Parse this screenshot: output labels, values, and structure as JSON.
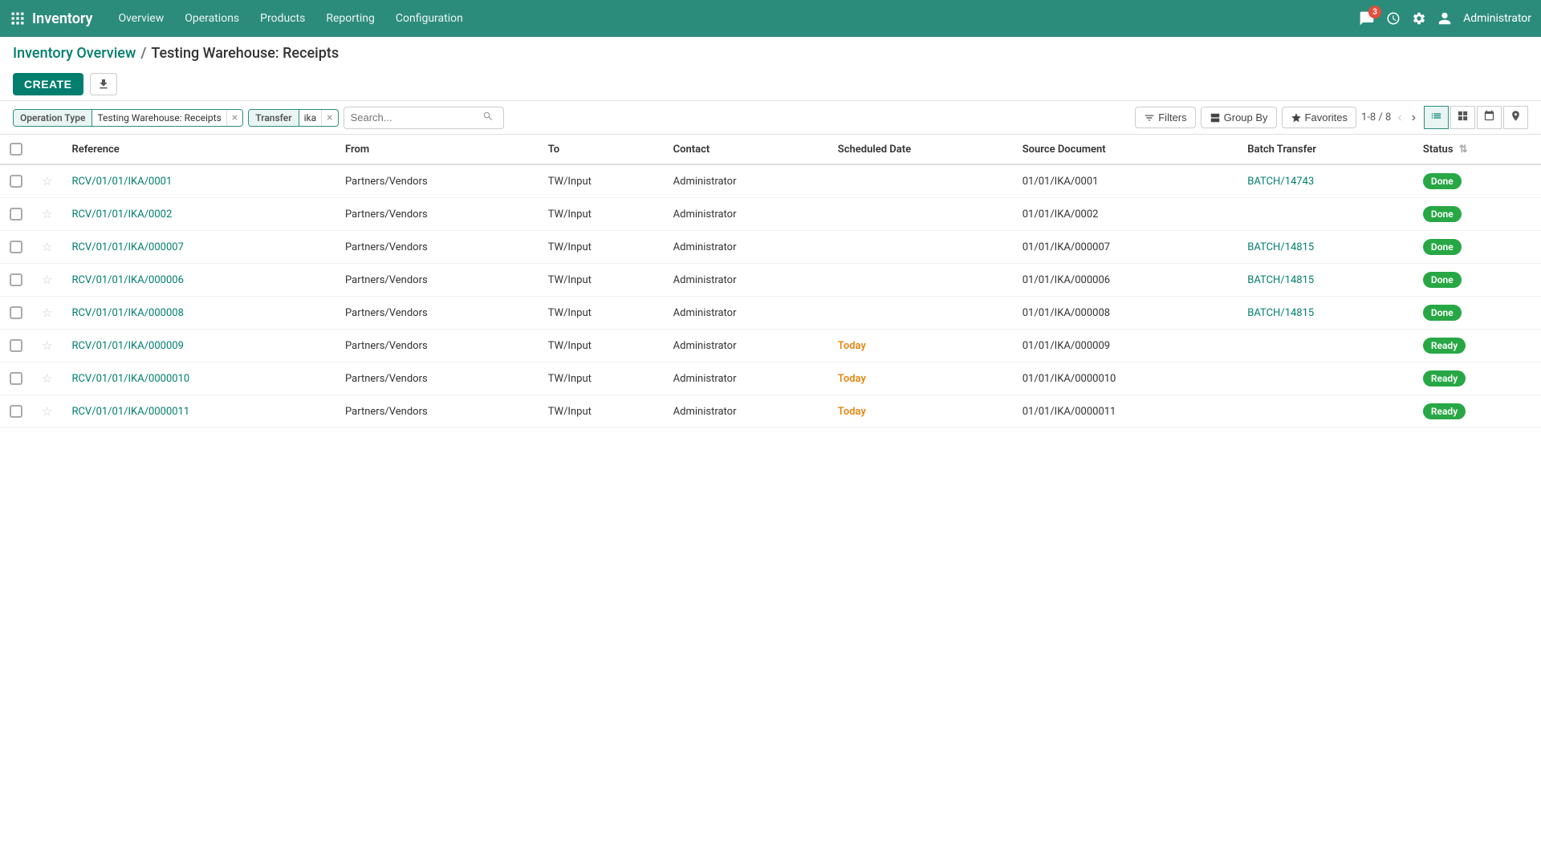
{
  "app": {
    "name": "Inventory",
    "nav_items": [
      "Overview",
      "Operations",
      "Products",
      "Reporting",
      "Configuration"
    ],
    "notification_count": "3",
    "user": "Administrator"
  },
  "breadcrumb": {
    "parent": "Inventory Overview",
    "separator": "/",
    "current": "Testing Warehouse: Receipts"
  },
  "toolbar": {
    "create_label": "CREATE",
    "download_tooltip": "Download"
  },
  "filters": {
    "operation_type_label": "Operation Type",
    "operation_type_value": "Testing Warehouse: Receipts",
    "transfer_label": "Transfer",
    "transfer_value": "ika",
    "search_placeholder": "Search..."
  },
  "view_controls": {
    "filters_label": "Filters",
    "group_by_label": "Group By",
    "favorites_label": "Favorites",
    "pagination": "1-8 / 8"
  },
  "table": {
    "columns": [
      "Reference",
      "From",
      "To",
      "Contact",
      "Scheduled Date",
      "Source Document",
      "Batch Transfer",
      "Status"
    ],
    "rows": [
      {
        "reference": "RCV/01/01/IKA/0001",
        "from": "Partners/Vendors",
        "to": "TW/Input",
        "contact": "Administrator",
        "scheduled_date": "",
        "source_document": "01/01/IKA/0001",
        "batch_transfer": "BATCH/14743",
        "status": "Done",
        "status_class": "status-done",
        "date_class": ""
      },
      {
        "reference": "RCV/01/01/IKA/0002",
        "from": "Partners/Vendors",
        "to": "TW/Input",
        "contact": "Administrator",
        "scheduled_date": "",
        "source_document": "01/01/IKA/0002",
        "batch_transfer": "",
        "status": "Done",
        "status_class": "status-done",
        "date_class": ""
      },
      {
        "reference": "RCV/01/01/IKA/000007",
        "from": "Partners/Vendors",
        "to": "TW/Input",
        "contact": "Administrator",
        "scheduled_date": "",
        "source_document": "01/01/IKA/000007",
        "batch_transfer": "BATCH/14815",
        "status": "Done",
        "status_class": "status-done",
        "date_class": ""
      },
      {
        "reference": "RCV/01/01/IKA/000006",
        "from": "Partners/Vendors",
        "to": "TW/Input",
        "contact": "Administrator",
        "scheduled_date": "",
        "source_document": "01/01/IKA/000006",
        "batch_transfer": "BATCH/14815",
        "status": "Done",
        "status_class": "status-done",
        "date_class": ""
      },
      {
        "reference": "RCV/01/01/IKA/000008",
        "from": "Partners/Vendors",
        "to": "TW/Input",
        "contact": "Administrator",
        "scheduled_date": "",
        "source_document": "01/01/IKA/000008",
        "batch_transfer": "BATCH/14815",
        "status": "Done",
        "status_class": "status-done",
        "date_class": ""
      },
      {
        "reference": "RCV/01/01/IKA/000009",
        "from": "Partners/Vendors",
        "to": "TW/Input",
        "contact": "Administrator",
        "scheduled_date": "Today",
        "source_document": "01/01/IKA/000009",
        "batch_transfer": "",
        "status": "Ready",
        "status_class": "status-ready",
        "date_class": "scheduled-today"
      },
      {
        "reference": "RCV/01/01/IKA/0000010",
        "from": "Partners/Vendors",
        "to": "TW/Input",
        "contact": "Administrator",
        "scheduled_date": "Today",
        "source_document": "01/01/IKA/0000010",
        "batch_transfer": "",
        "status": "Ready",
        "status_class": "status-ready",
        "date_class": "scheduled-today"
      },
      {
        "reference": "RCV/01/01/IKA/0000011",
        "from": "Partners/Vendors",
        "to": "TW/Input",
        "contact": "Administrator",
        "scheduled_date": "Today",
        "source_document": "01/01/IKA/0000011",
        "batch_transfer": "",
        "status": "Ready",
        "status_class": "status-ready",
        "date_class": "scheduled-today"
      }
    ]
  }
}
